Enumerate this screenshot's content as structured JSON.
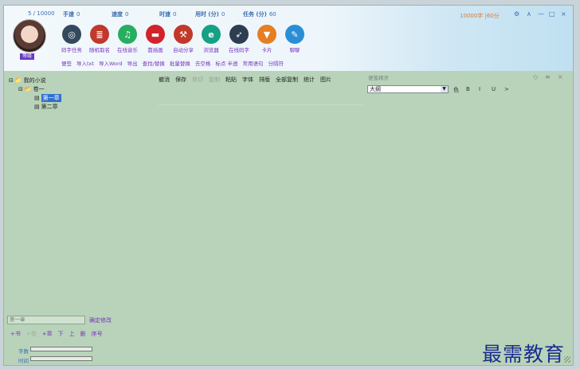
{
  "stats": {
    "count": "5 / 10000",
    "speed_label": "手速",
    "speed_value": "0",
    "rate_label": "速度",
    "rate_value": "0",
    "time_label": "时速",
    "time_value": "0",
    "used_label": "用时 (分)",
    "used_value": "0",
    "task_label": "任务 (分)",
    "task_value": "60"
  },
  "level_badge": "等级",
  "toolbar": [
    {
      "label": "码字任务",
      "icon": "speedometer-icon",
      "color": "#34495e",
      "glyph": "◎"
    },
    {
      "label": "随机取名",
      "icon": "notebook-icon",
      "color": "#c0392b",
      "glyph": "≣"
    },
    {
      "label": "在线音乐",
      "icon": "music-icon",
      "color": "#27ae60",
      "glyph": "♫"
    },
    {
      "label": "靠插画",
      "icon": "minus-icon",
      "color": "#d2232a",
      "glyph": "▬"
    },
    {
      "label": "自动分享",
      "icon": "compass-icon",
      "color": "#c0392b",
      "glyph": "⚒"
    },
    {
      "label": "浏览器",
      "icon": "browser-icon",
      "color": "#16a085",
      "glyph": "e"
    },
    {
      "label": "在线码字",
      "icon": "rocket-icon",
      "color": "#2c3e50",
      "glyph": "➶"
    },
    {
      "label": "卡片",
      "icon": "bookmark-icon",
      "color": "#e67e22",
      "glyph": "▼"
    },
    {
      "label": "聊聊",
      "icon": "chat-icon",
      "color": "#2a8ed6",
      "glyph": "✎"
    }
  ],
  "links": [
    "便签",
    "导入txt",
    "导入Word",
    "导出",
    "查找/替换",
    "批量替换",
    "去空格",
    "标点 半透",
    "常用语句",
    "分隔符"
  ],
  "word_goal": "10000字 |60分",
  "window_controls": {
    "settings": "⚙",
    "up": "∧",
    "min": "—",
    "max": "□",
    "close": "×"
  },
  "tree": {
    "root": "我的小说",
    "volume": "卷一",
    "chapters": [
      "第一章",
      "第二章"
    ]
  },
  "edit_toolbar": [
    "撤消",
    "保存",
    "剪切",
    "复制",
    "粘贴",
    "字体",
    "排版",
    "全部复制",
    "统计",
    "图片"
  ],
  "edit_disabled": [
    false,
    false,
    true,
    true,
    false,
    false,
    false,
    false,
    false,
    false
  ],
  "notes": {
    "title": "便笺精灵",
    "select": "大纲",
    "tools": [
      "色",
      "B",
      "I",
      "U",
      ">"
    ],
    "pin": "◇",
    "menu": "≡",
    "close": "×"
  },
  "rename": {
    "value": "第一章",
    "button": "确定修改"
  },
  "ops": [
    "+书",
    "+卷",
    "+章",
    "下",
    "上",
    "删",
    "序号"
  ],
  "ops_disabled": [
    false,
    true,
    false,
    false,
    false,
    false,
    false
  ],
  "progress": {
    "words_label": "字数",
    "time_label": "时间"
  },
  "watermark": "最需教育"
}
